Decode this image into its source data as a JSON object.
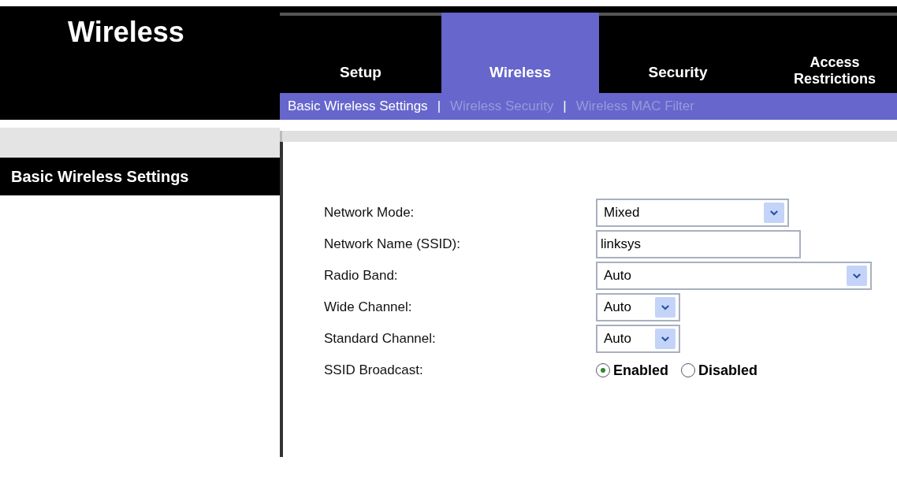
{
  "page_title": "Wireless",
  "tabs": [
    {
      "label": "Setup",
      "selected": false
    },
    {
      "label": "Wireless",
      "selected": true
    },
    {
      "label": "Security",
      "selected": false
    },
    {
      "label": "Access Restrictions",
      "selected": false
    }
  ],
  "subnav": [
    {
      "label": "Basic Wireless Settings",
      "selected": true
    },
    {
      "label": "Wireless Security",
      "selected": false
    },
    {
      "label": "Wireless MAC Filter",
      "selected": false
    }
  ],
  "subnav_separator": "|",
  "sidebar_heading": "Basic Wireless Settings",
  "fields": [
    {
      "kind": "select",
      "label": "Network Mode:",
      "value": "Mixed"
    },
    {
      "kind": "text",
      "label": "Network Name (SSID):",
      "value": "linksys"
    },
    {
      "kind": "select",
      "label": "Radio Band:",
      "value": "Auto"
    },
    {
      "kind": "select",
      "label": "Wide Channel:",
      "value": "Auto"
    },
    {
      "kind": "select",
      "label": "Standard Channel:",
      "value": "Auto"
    },
    {
      "kind": "radio",
      "label": "SSID Broadcast:",
      "options": [
        {
          "label": "Enabled",
          "selected": true
        },
        {
          "label": "Disabled",
          "selected": false
        }
      ]
    }
  ]
}
